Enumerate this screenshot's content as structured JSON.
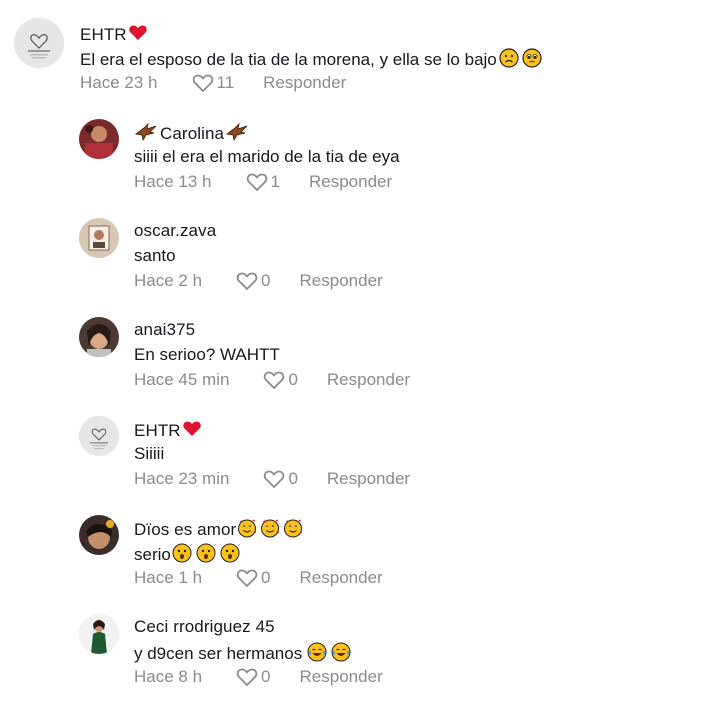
{
  "comments": [
    {
      "username": "EHTR",
      "text": "El era el esposo de la tia de la morena, y ella se lo bajo",
      "time": "Hace 23 h",
      "likes": "11",
      "reply_label": "Responder"
    },
    {
      "username": "Carolina",
      "text": "siiii el era el marido de la tia de eya",
      "time": "Hace 13 h",
      "likes": "1",
      "reply_label": "Responder"
    },
    {
      "username": "oscar.zava",
      "text": "santo",
      "time": "Hace 2 h",
      "likes": "0",
      "reply_label": "Responder"
    },
    {
      "username": "anai375",
      "text": "En serioo? WAHTT",
      "time": "Hace 45 min",
      "likes": "0",
      "reply_label": "Responder"
    },
    {
      "username": "EHTR",
      "text": "Siiiii",
      "time": "Hace 23 min",
      "likes": "0",
      "reply_label": "Responder"
    },
    {
      "username": "Dïos es amor",
      "text": "serio",
      "time": "Hace 1 h",
      "likes": "0",
      "reply_label": "Responder"
    },
    {
      "username": "Ceci rrodriguez 45",
      "text": "y d9cen ser hermanos",
      "time": "Hace 8 h",
      "likes": "0",
      "reply_label": "Responder"
    }
  ],
  "icons": {
    "like": "heart-outline-icon",
    "username_badge": "red-heart-icon",
    "reaction_sad": "frowning-face-icon",
    "reaction_pleading": "pleading-face-icon",
    "reaction_wow": "astonished-face-icon",
    "reaction_love": "smiling-hearts-face-icon",
    "reaction_laugh": "tears-of-joy-icon",
    "flag": "eagle-icon"
  },
  "colors": {
    "text": "#161823",
    "muted": "#8a8b91",
    "heart": "#fe2c55"
  }
}
